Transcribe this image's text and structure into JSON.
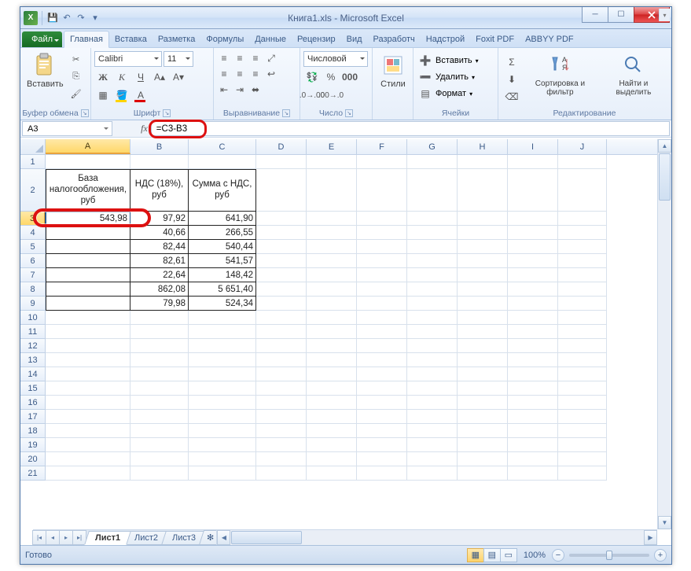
{
  "window": {
    "title": "Книга1.xls - Microsoft Excel",
    "min": "_",
    "max": "❐",
    "close": "✕"
  },
  "qat": {
    "save": "💾",
    "undo": "↶",
    "redo": "↷"
  },
  "tabs": {
    "file": "Файл",
    "items": [
      "Главная",
      "Вставка",
      "Разметка",
      "Формулы",
      "Данные",
      "Рецензир",
      "Вид",
      "Разработч",
      "Надстрой",
      "Foxit PDF",
      "ABBYY PDF"
    ],
    "active": 0
  },
  "ribbon": {
    "clipboard": {
      "paste": "Вставить",
      "label": "Буфер обмена"
    },
    "font": {
      "name": "Calibri",
      "size": "11",
      "label": "Шрифт",
      "bold": "Ж",
      "italic": "К",
      "underline": "Ч"
    },
    "align": {
      "label": "Выравнивание",
      "wrap": "≡",
      "merge": "⬌"
    },
    "number": {
      "format": "Числовой",
      "label": "Число"
    },
    "styles": {
      "btn": "Стили",
      "label": ""
    },
    "cells": {
      "insert": "Вставить",
      "delete": "Удалить",
      "format": "Формат",
      "label": "Ячейки"
    },
    "editing": {
      "sort": "Сортировка и фильтр",
      "find": "Найти и выделить",
      "label": "Редактирование"
    }
  },
  "formulaBar": {
    "name": "A3",
    "formula": "=C3-B3"
  },
  "grid": {
    "columns": [
      {
        "id": "A",
        "w": 108
      },
      {
        "id": "B",
        "w": 74
      },
      {
        "id": "C",
        "w": 86
      },
      {
        "id": "D",
        "w": 64
      },
      {
        "id": "E",
        "w": 64
      },
      {
        "id": "F",
        "w": 64
      },
      {
        "id": "G",
        "w": 64
      },
      {
        "id": "H",
        "w": 64
      },
      {
        "id": "I",
        "w": 64
      },
      {
        "id": "J",
        "w": 62
      }
    ],
    "visibleRows": 21,
    "headers": {
      "A": "База\nналогообложения,\nруб",
      "B": "НДС (18%),\nруб",
      "C": "Сумма с НДС,\nруб"
    },
    "data": [
      {
        "A": "543,98",
        "B": "97,92",
        "C": "641,90"
      },
      {
        "A": "",
        "B": "40,66",
        "C": "266,55"
      },
      {
        "A": "",
        "B": "82,44",
        "C": "540,44"
      },
      {
        "A": "",
        "B": "82,61",
        "C": "541,57"
      },
      {
        "A": "",
        "B": "22,64",
        "C": "148,42"
      },
      {
        "A": "",
        "B": "862,08",
        "C": "5 651,40"
      },
      {
        "A": "",
        "B": "79,98",
        "C": "524,34"
      }
    ],
    "selected": {
      "row": 3,
      "col": "A"
    }
  },
  "sheets": {
    "tabs": [
      "Лист1",
      "Лист2",
      "Лист3"
    ],
    "active": 0
  },
  "status": {
    "ready": "Готово",
    "zoom": "100%"
  }
}
